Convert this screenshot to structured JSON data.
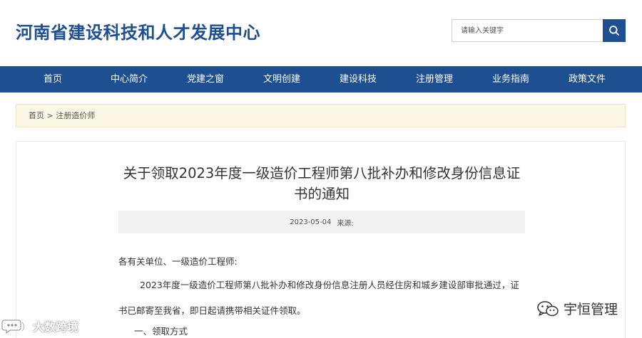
{
  "header": {
    "site_title": "河南省建设科技和人才发展中心",
    "search_placeholder": "请输入关键字"
  },
  "nav": {
    "items": [
      {
        "label": "首页"
      },
      {
        "label": "中心简介"
      },
      {
        "label": "党建之窗"
      },
      {
        "label": "文明创建"
      },
      {
        "label": "建设科技"
      },
      {
        "label": "注册管理"
      },
      {
        "label": "业务指南"
      },
      {
        "label": "政策文件"
      }
    ]
  },
  "breadcrumb": {
    "home": "首页",
    "separator": ">",
    "current": "注册造价师"
  },
  "article": {
    "title": "关于领取2023年度一级造价工程师第八批补办和修改身份信息证书的通知",
    "date": "2023-05-04",
    "source_label": "来源:",
    "salutation": "各有关单位、一级造价工程师:",
    "para1_line1": "2023年度一级造价工程师第八批补办和修改身份信息注册人员经住房和城乡建设部审批通过，证",
    "para1_line2": "书已邮寄至我省，即日起请携带相关证件领取。",
    "section1": "一、领取方式"
  },
  "watermarks": {
    "left": "大数跨境",
    "right": "宇恒管理"
  },
  "colors": {
    "brand_blue": "#1d4f91",
    "breadcrumb_bg": "#fdf8e6"
  }
}
